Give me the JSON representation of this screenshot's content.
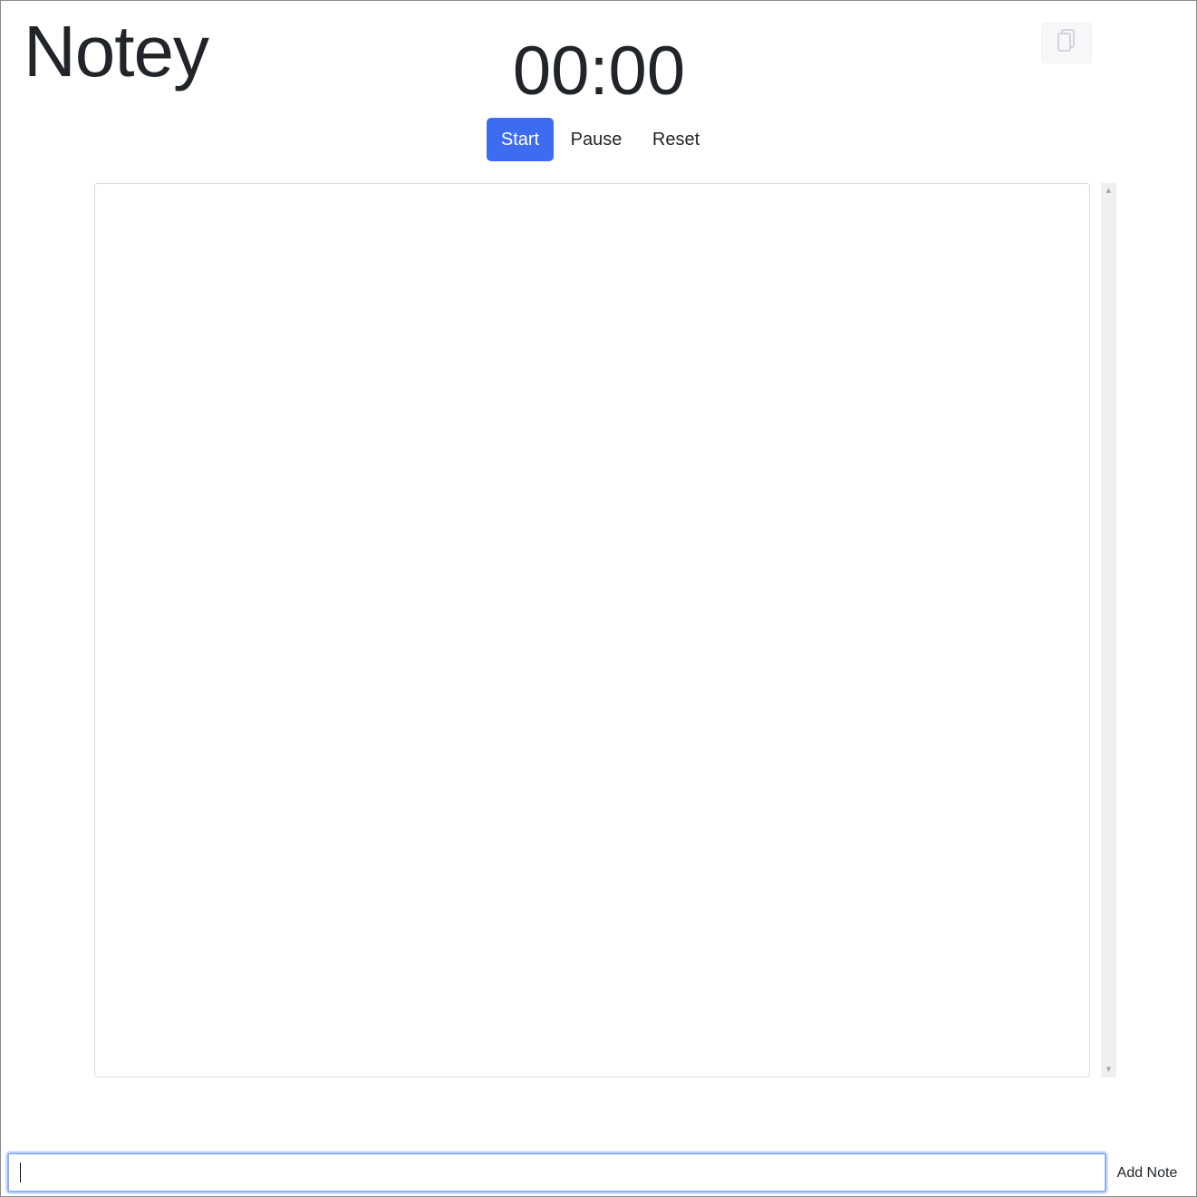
{
  "header": {
    "app_title": "Notey",
    "timer_display": "00:00",
    "copy_icon": "copy-icon"
  },
  "controls": {
    "start_label": "Start",
    "pause_label": "Pause",
    "reset_label": "Reset",
    "start_color": "#3d6cf2"
  },
  "notes": {
    "content": ""
  },
  "composer": {
    "input_value": "",
    "add_note_label": "Add Note",
    "focus_color": "#8fb0f5"
  }
}
